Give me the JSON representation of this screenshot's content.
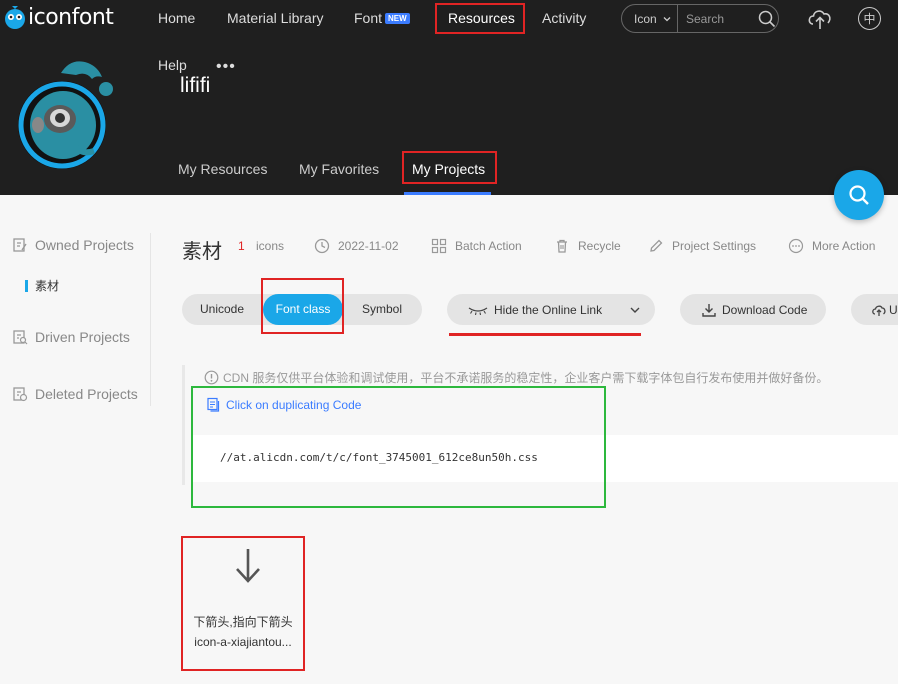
{
  "app": {
    "logo_text": "iconfont"
  },
  "nav": {
    "home": "Home",
    "material_library": "Material Library",
    "font": "Font",
    "font_badge": "NEW",
    "resources": "Resources",
    "activity": "Activity"
  },
  "search": {
    "type": "Icon",
    "placeholder": "Search"
  },
  "lang_label": "中",
  "profile": {
    "help": "Help",
    "more": "•••",
    "username": "lififi"
  },
  "profile_tabs": [
    "My Resources",
    "My Favorites",
    "My Projects"
  ],
  "sidebar": {
    "owned": "Owned Projects",
    "owned_sub": "素材",
    "driven": "Driven Projects",
    "deleted": "Deleted Projects"
  },
  "project": {
    "title": "素材",
    "count": "1",
    "count_unit": "icons",
    "date": "2022-11-02",
    "batch": "Batch Action",
    "recycle": "Recycle",
    "settings": "Project Settings",
    "more": "More Action"
  },
  "modes": {
    "unicode": "Unicode",
    "fontclass": "Font class",
    "symbol": "Symbol",
    "active": "Font class"
  },
  "actions": {
    "hide_link": "Hide the Online Link",
    "download": "Download Code",
    "upload_partial": "U"
  },
  "notice": "CDN 服务仅供平台体验和调试使用，平台不承诺服务的稳定性，企业客户需下载字体包自行发布使用并做好备份。",
  "duplicate": "Click on duplicating Code",
  "code": "//at.alicdn.com/t/c/font_3745001_612ce8un50h.css",
  "icon_item": {
    "name": "下箭头,指向下箭头",
    "code": "icon-a-xiajiantou..."
  },
  "colors": {
    "accent": "#1aa7e8",
    "header_bg": "#1f1f1f",
    "highlight_red": "#e02424",
    "highlight_green": "#2db83d",
    "link_blue": "#3b7cff"
  }
}
